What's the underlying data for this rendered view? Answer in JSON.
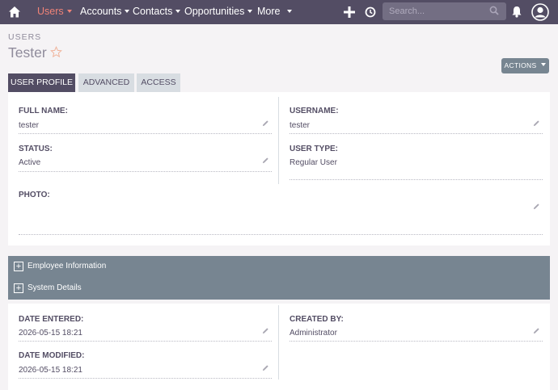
{
  "nav": {
    "items": [
      {
        "label": "Users",
        "active": true
      },
      {
        "label": "Accounts"
      },
      {
        "label": "Contacts"
      },
      {
        "label": "Opportunities"
      },
      {
        "label": "More"
      }
    ],
    "search_placeholder": "Search..."
  },
  "header": {
    "module": "USERS",
    "title": "Tester",
    "actions_label": "ACTIONS"
  },
  "tabs": [
    "USER PROFILE",
    "ADVANCED",
    "ACCESS"
  ],
  "profile": {
    "full_name_label": "FULL NAME:",
    "full_name": "tester",
    "username_label": "USERNAME:",
    "username": "tester",
    "status_label": "STATUS:",
    "status": "Active",
    "user_type_label": "USER TYPE:",
    "user_type": "Regular User",
    "photo_label": "PHOTO:"
  },
  "groups": [
    "Employee Information",
    "System Details"
  ],
  "system": {
    "date_entered_label": "DATE ENTERED:",
    "date_entered": "2026-05-15 18:21",
    "created_by_label": "CREATED BY:",
    "created_by": "Administrator",
    "date_modified_label": "DATE MODIFIED:",
    "date_modified": "2026-05-15 18:21"
  },
  "colors": {
    "nav_bg": "#534d64",
    "accent": "#f08377",
    "group_bg": "#778591"
  }
}
